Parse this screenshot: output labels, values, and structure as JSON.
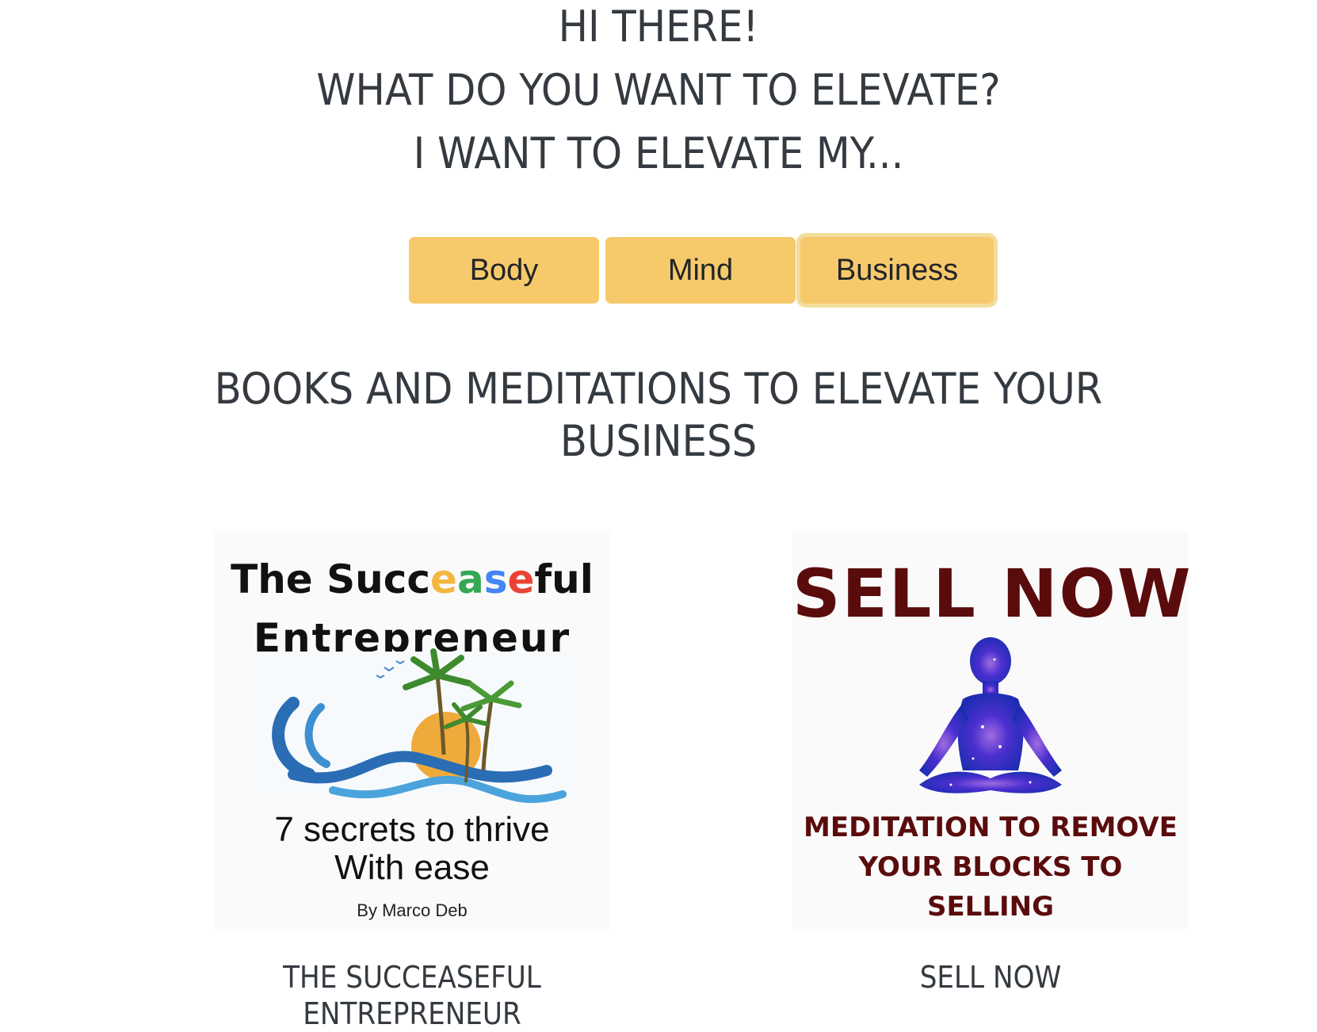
{
  "hero": {
    "line1": "HI THERE!",
    "line2": "WHAT DO YOU WANT TO ELEVATE?",
    "line3": "I WANT TO ELEVATE MY..."
  },
  "filters": {
    "body_label": "Body",
    "mind_label": "Mind",
    "business_label": "Business",
    "selected": "Business"
  },
  "section": {
    "title_line1": "BOOKS AND MEDITATIONS TO ELEVATE YOUR",
    "title_line2": "BUSINESS"
  },
  "products": [
    {
      "title_line1": "THE SUCCEASEFUL",
      "title_line2": "ENTREPRENEUR",
      "cover": {
        "heading_prefix": "The Succ",
        "heading_letters": [
          "e",
          "a",
          "s",
          "e"
        ],
        "heading_suffix": "ful",
        "heading_line2": "Entrepreneur",
        "tagline_line1": "7 secrets to thrive",
        "tagline_line2": "With ease",
        "author": "By Marco Deb"
      }
    },
    {
      "title_line1": "SELL NOW",
      "cover": {
        "heading": "SELL NOW",
        "subtitle_line1": "MEDITATION TO REMOVE",
        "subtitle_line2": "YOUR BLOCKS TO",
        "subtitle_line3": "SELLING"
      }
    }
  ],
  "colors": {
    "button_bg": "#f6c96b",
    "text": "#343a40",
    "letter_colors": [
      "#f4b63f",
      "#34a853",
      "#4285f4",
      "#ea4335"
    ],
    "sell_now_red": "#5a0c0c"
  }
}
